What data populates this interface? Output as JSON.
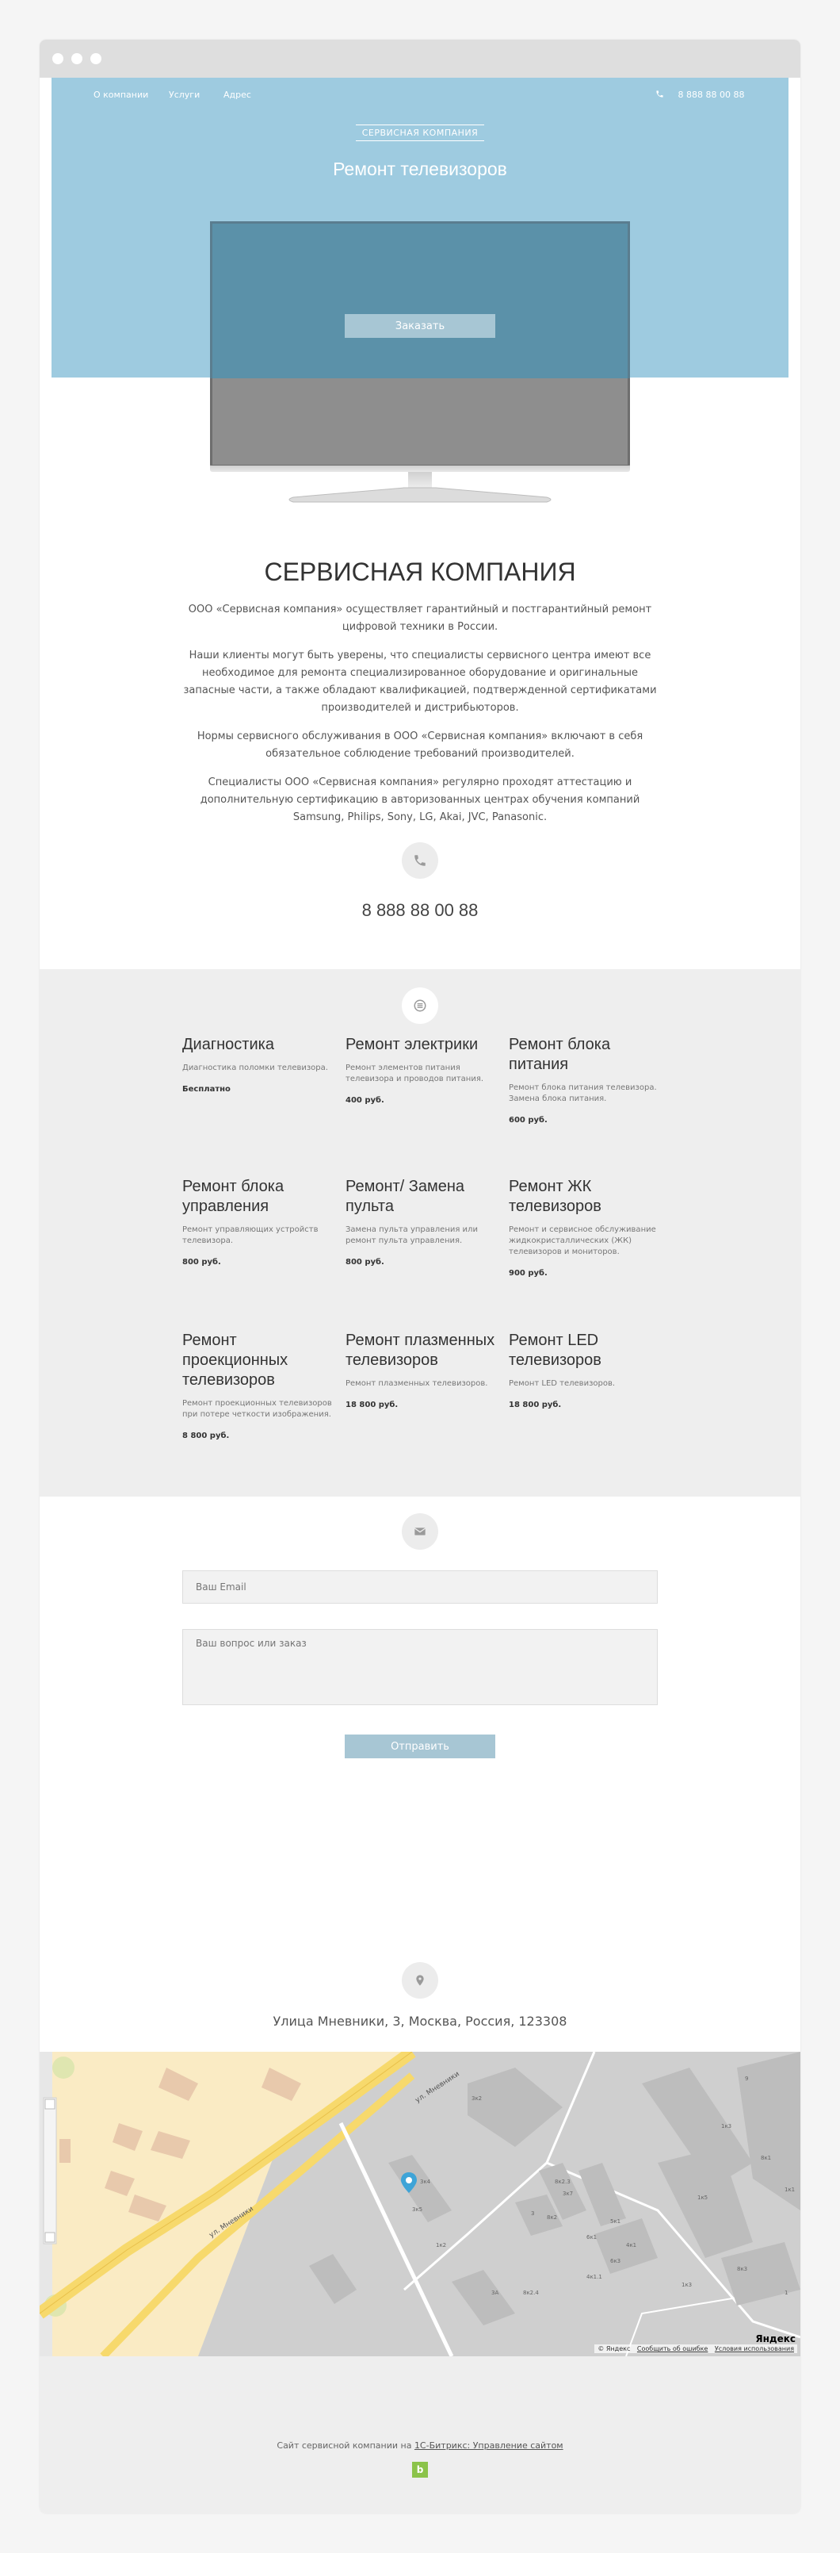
{
  "nav": {
    "items": [
      "О компании",
      "Услуги",
      "Адрес"
    ],
    "phone": "8 888 88 00 88"
  },
  "hero": {
    "tag": "СЕРВИСНАЯ КОМПАНИЯ",
    "title": "Ремонт телевизоров",
    "order_button": "Заказать"
  },
  "about": {
    "title": "СЕРВИСНАЯ КОМПАНИЯ",
    "paragraphs": [
      "ООО «Сервисная компания» осуществляет гарантийный и постгарантийный ремонт цифровой техники в России.",
      "Наши клиенты могут быть уверены, что специалисты сервисного центра имеют все необходимое для ремонта специализированное оборудование и оригинальные запасные части, а также обладают квалификацией, подтвержденной сертификатами производителей и дистрибьюторов.",
      "Нормы сервисного обслуживания в ООО «Сервисная компания» включают в себя обязательное соблюдение требований производителей.",
      "Специалисты ООО «Сервисная компания» регулярно проходят аттестацию и дополнительную сертификацию в авторизованных центрах обучения компаний Samsung, Philips, Sony, LG, Akai, JVC, Panasonic."
    ],
    "phone": "8 888 88 00 88"
  },
  "services": [
    {
      "title": "Диагностика",
      "desc": "Диагностика поломки телевизора.",
      "price": "Бесплатно"
    },
    {
      "title": "Ремонт электрики",
      "desc": "Ремонт элементов питания телевизора и проводов питания.",
      "price": "400 руб."
    },
    {
      "title": "Ремонт блока питания",
      "desc": "Ремонт блока питания телевизора. Замена блока питания.",
      "price": "600 руб."
    },
    {
      "title": "Ремонт блока управления",
      "desc": "Ремонт управляющих устройств телевизора.",
      "price": "800 руб."
    },
    {
      "title": "Ремонт/ Замена пульта",
      "desc": "Замена пульта управления или ремонт пульта управления.",
      "price": "800 руб."
    },
    {
      "title": "Ремонт ЖК телевизоров",
      "desc": "Ремонт и сервисное обслуживание жидкокристаллических (ЖК) телевизоров и мониторов.",
      "price": "900 руб."
    },
    {
      "title": "Ремонт проекционных телевизоров",
      "desc": "Ремонт проекционных телевизоров при потере четкости изображения.",
      "price": "8 800 руб."
    },
    {
      "title": "Ремонт плазменных телевизоров",
      "desc": "Ремонт плазменных телевизоров.",
      "price": "18 800 руб."
    },
    {
      "title": "Ремонт LED телевизоров",
      "desc": "Ремонт LED телевизоров.",
      "price": "18 800 руб."
    }
  ],
  "form": {
    "email_placeholder": "Ваш Email",
    "question_placeholder": "Ваш вопрос или заказ",
    "submit": "Отправить"
  },
  "address": "Улица Мневники, 3, Москва, Россия, 123308",
  "map": {
    "street_label": "ул. Мневники",
    "logo": "Яндекс",
    "copyright": "© Яндекс",
    "report_link": "Сообщить об ошибке",
    "terms_link": "Условия использования",
    "house_labels": [
      "3к2",
      "3к5",
      "3к7",
      "3",
      "3А",
      "9",
      "5к1",
      "8к1",
      "1к1",
      "1к3",
      "1к5",
      "8к2",
      "6к1",
      "4к1",
      "3к4",
      "8к2.3",
      "6к3",
      "4к1.1",
      "8к2.4",
      "1к2",
      "1к3",
      "8к3",
      "1"
    ]
  },
  "footer": {
    "text": "Сайт сервисной компании на ",
    "link": "1С-Битрикс: Управление сайтом",
    "badge": "b"
  }
}
